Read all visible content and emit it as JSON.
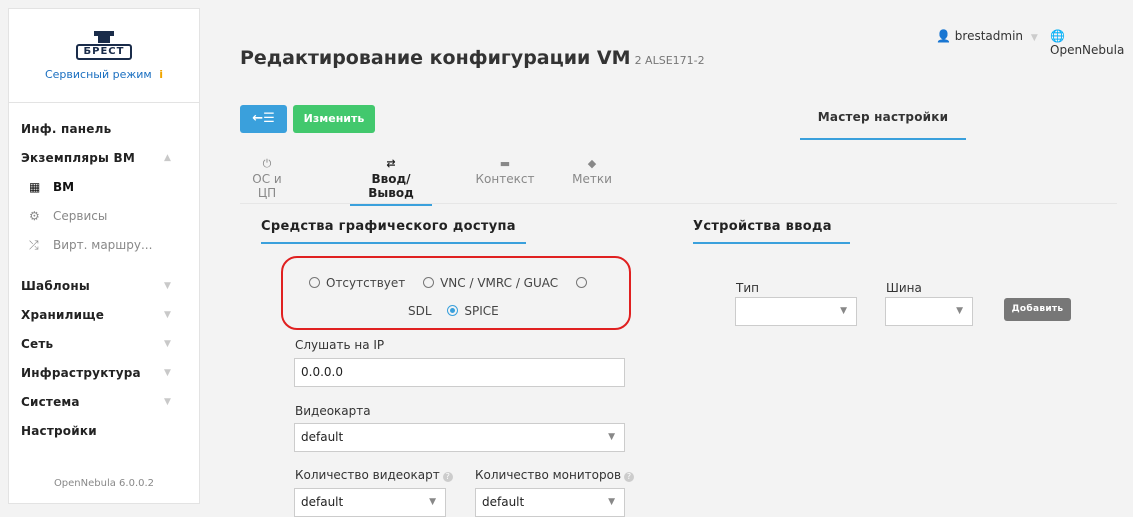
{
  "brand": {
    "logo_text": "БРЕСТ",
    "service_mode": "Сервисный режим",
    "info_icon": "i",
    "version": "OpenNebula 6.0.0.2"
  },
  "sidebar": {
    "dashboard": "Инф. панель",
    "vm_instances": "Экземпляры ВМ",
    "vm": "ВМ",
    "services": "Сервисы",
    "vrouters": "Вирт. маршру...",
    "templates": "Шаблоны",
    "storage": "Хранилище",
    "network": "Сеть",
    "infrastructure": "Инфраструктура",
    "system": "Система",
    "settings": "Настройки"
  },
  "header": {
    "title": "Редактирование конфигурации VM",
    "subtitle": "2 ALSE171-2",
    "user": "brestadmin",
    "zone": "OpenNebula"
  },
  "toolbar": {
    "back_icon": "←☰",
    "save_label": "Изменить",
    "wizard_label": "Мастер настройки"
  },
  "tabs": {
    "os_cpu": "ОС и ЦП",
    "io": "Ввод/Вывод",
    "context": "Контекст",
    "tags": "Метки"
  },
  "graphics": {
    "title": "Средства графического доступа",
    "options": {
      "none": "Отсутствует",
      "vnc": "VNC / VMRC / GUAC",
      "sdl": "SDL",
      "spice": "SPICE"
    },
    "selected": "SPICE",
    "listen_label": "Слушать на IP",
    "listen_value": "0.0.0.0",
    "video_label": "Видеокарта",
    "video_value": "default",
    "video_count_label": "Количество видеокарт",
    "video_count_value": "default",
    "monitors_label": "Количество мониторов",
    "monitors_value": "default"
  },
  "input_devices": {
    "title": "Устройства ввода",
    "type_label": "Тип",
    "type_value": "",
    "bus_label": "Шина",
    "bus_value": "",
    "add_label": "Добавить"
  },
  "colors": {
    "accent": "#3aa0dc",
    "success": "#42c86d",
    "highlight": "#e02020"
  }
}
